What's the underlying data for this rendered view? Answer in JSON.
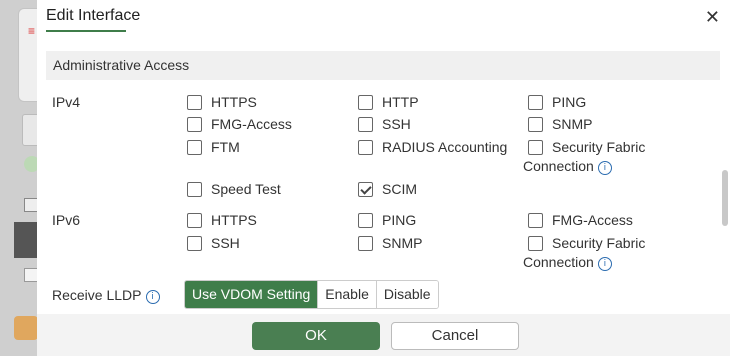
{
  "dialog": {
    "title": "Edit Interface",
    "close_icon": "close-icon"
  },
  "section": {
    "title": "Administrative Access"
  },
  "ipv4": {
    "label": "IPv4",
    "options": [
      {
        "label": "HTTPS",
        "checked": false
      },
      {
        "label": "HTTP",
        "checked": false
      },
      {
        "label": "PING",
        "checked": false
      },
      {
        "label": "FMG-Access",
        "checked": false
      },
      {
        "label": "SSH",
        "checked": false
      },
      {
        "label": "SNMP",
        "checked": false
      },
      {
        "label": "FTM",
        "checked": false
      },
      {
        "label": "RADIUS Accounting",
        "checked": false
      },
      {
        "label": "Security Fabric",
        "continuation": "Connection",
        "checked": false
      },
      {
        "label": "Speed Test",
        "checked": false
      },
      {
        "label": "SCIM",
        "checked": true
      }
    ]
  },
  "ipv6": {
    "label": "IPv6",
    "options": [
      {
        "label": "HTTPS",
        "checked": false
      },
      {
        "label": "PING",
        "checked": false
      },
      {
        "label": "FMG-Access",
        "checked": false
      },
      {
        "label": "SSH",
        "checked": false
      },
      {
        "label": "SNMP",
        "checked": false
      },
      {
        "label": "Security Fabric",
        "continuation": "Connection",
        "checked": false
      }
    ]
  },
  "lldp": {
    "label": "Receive LLDP",
    "options": [
      "Use VDOM Setting",
      "Enable",
      "Disable"
    ],
    "selected": "Use VDOM Setting"
  },
  "footer": {
    "ok": "OK",
    "cancel": "Cancel"
  },
  "colors": {
    "accent": "#4a7f52",
    "section_bg": "#f0f0f0"
  }
}
